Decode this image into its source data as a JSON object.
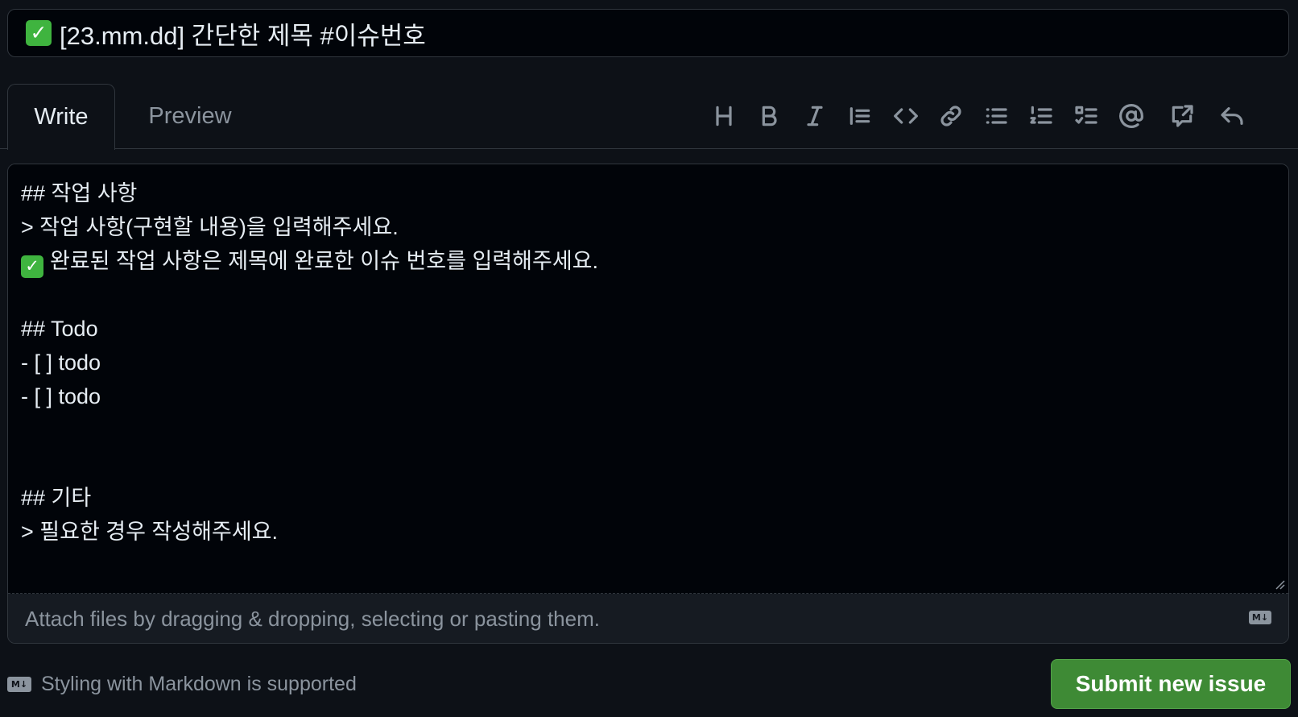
{
  "title": {
    "check_icon": "check-mark-emoji-icon",
    "value": "[23.mm.dd] 간단한 제목 #이슈번호"
  },
  "tabs": [
    {
      "label": "Write",
      "active": true
    },
    {
      "label": "Preview",
      "active": false
    }
  ],
  "toolbar": {
    "icons": [
      "heading-icon",
      "bold-icon",
      "italic-icon",
      "quote-icon",
      "code-icon",
      "link-icon",
      "bulleted-list-icon",
      "numbered-list-icon",
      "task-list-icon",
      "mention-icon",
      "cross-reference-icon",
      "saved-reply-icon"
    ]
  },
  "editor": {
    "lines": [
      "## 작업 사항",
      "> 작업 사항(구현할 내용)을 입력해주세요.",
      "완료된 작업 사항은 제목에 완료한 이슈 번호를 입력해주세요.",
      "",
      "## Todo",
      "- [ ] todo",
      "- [ ] todo",
      "",
      "",
      "## 기타",
      "> 필요한 경우 작성해주세요."
    ]
  },
  "attach": {
    "text": "Attach files by dragging & dropping, selecting or pasting them.",
    "md_badge": "M↓"
  },
  "footer": {
    "md_badge": "M↓",
    "note": "Styling with Markdown is supported",
    "submit_label": "Submit new issue"
  },
  "colors": {
    "background": "#0d1117",
    "input_background": "#010409",
    "border": "#30363d",
    "muted_text": "#8b949e",
    "submit_green": "#3e8a35",
    "check_green": "#3fb43f"
  }
}
